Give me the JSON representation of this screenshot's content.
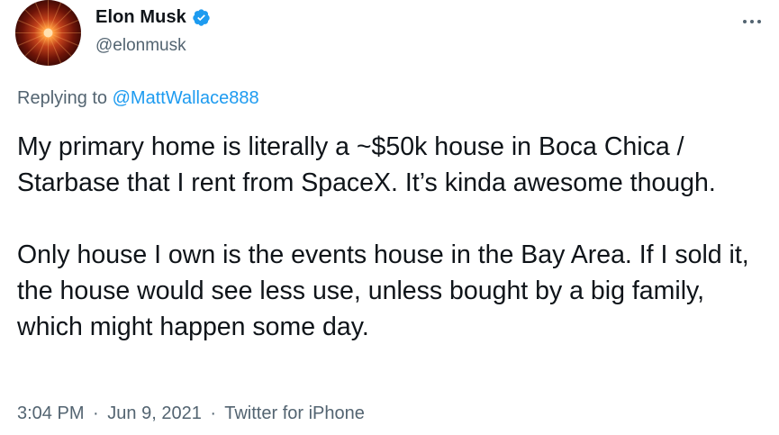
{
  "author": {
    "display_name": "Elon Musk",
    "handle": "@elonmusk",
    "verified": true
  },
  "reply": {
    "prefix": "Replying to",
    "target": "@MattWallace888"
  },
  "body": {
    "paragraph_1": "My primary home is literally a ~$50k house in Boca Chica / Starbase that I rent from SpaceX. It’s kinda awesome though.",
    "paragraph_2": "Only house I own is the events house in the Bay Area. If I sold it, the house would see less use, unless bought by a big family, which might happen some day."
  },
  "meta": {
    "time": "3:04 PM",
    "separator": "·",
    "date": "Jun 9, 2021",
    "source": "Twitter for iPhone"
  },
  "icons": {
    "more": "more-options-icon",
    "verified": "verified-badge-icon"
  },
  "colors": {
    "link": "#1d9bf0",
    "secondary": "#536471",
    "text": "#0f1419"
  }
}
